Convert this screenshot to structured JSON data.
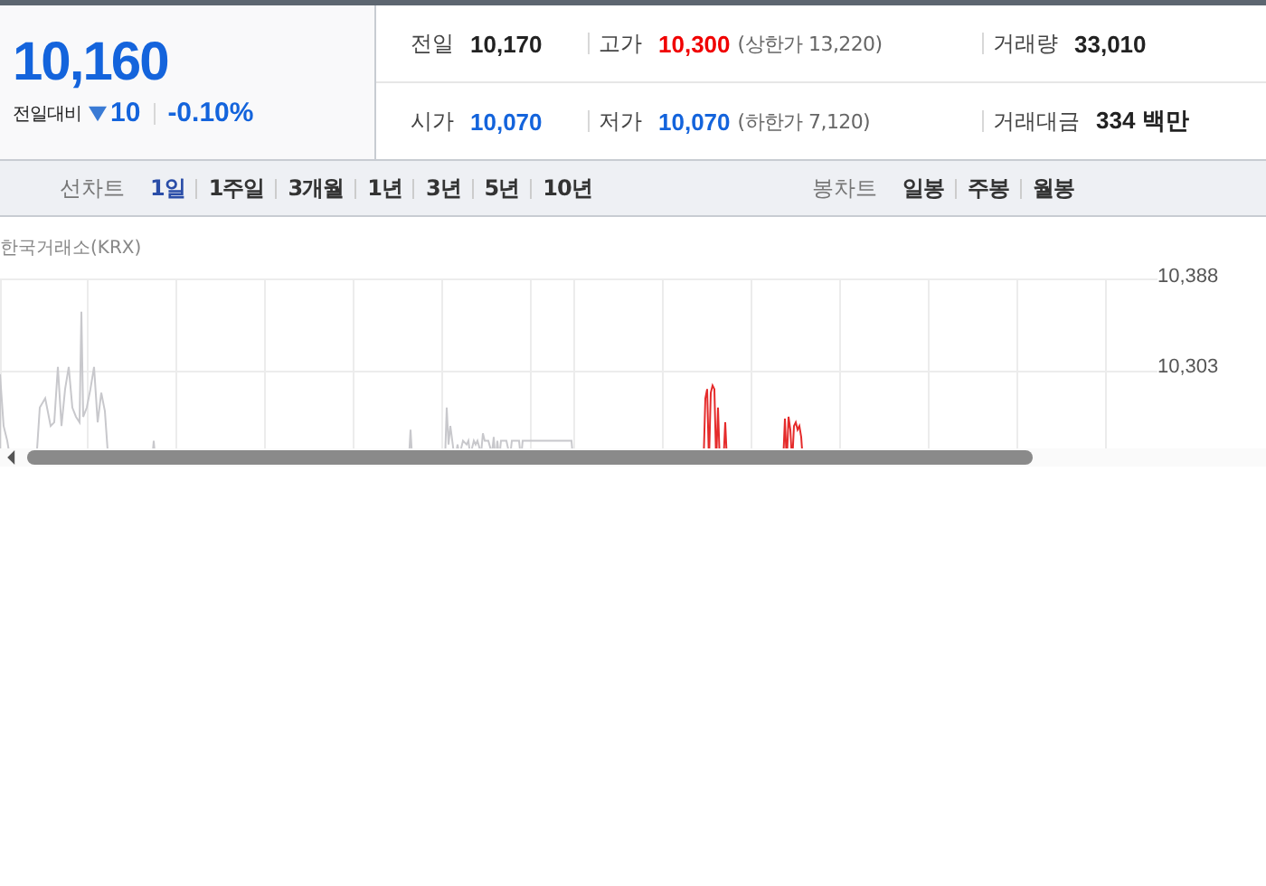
{
  "quote": {
    "price": "10,160",
    "change_label": "전일대비",
    "falling": true,
    "change": "10",
    "rate": "-0.10%"
  },
  "stats": [
    [
      {
        "label": "전일",
        "value": "10,170",
        "kind": "plain"
      },
      {
        "label": "고가",
        "value": "10,300",
        "kind": "up",
        "note": "(상한가 13,220)"
      },
      {
        "label": "거래량",
        "value": "33,010",
        "kind": "plain"
      }
    ],
    [
      {
        "label": "시가",
        "value": "10,070",
        "kind": "down"
      },
      {
        "label": "저가",
        "value": "10,070",
        "kind": "down",
        "note": "(하한가 7,120)"
      },
      {
        "label": "거래대금",
        "value": "334 백만",
        "kind": "plain"
      }
    ]
  ],
  "line_chart": {
    "label": "선차트",
    "periods": [
      {
        "label": "1일",
        "selected": true
      },
      {
        "label": "1주일",
        "selected": false
      },
      {
        "label": "3개월",
        "selected": false
      },
      {
        "label": "1년",
        "selected": false
      },
      {
        "label": "3년",
        "selected": false
      },
      {
        "label": "5년",
        "selected": false
      },
      {
        "label": "10년",
        "selected": false
      }
    ]
  },
  "candle_chart": {
    "label": "봉차트",
    "periods": [
      {
        "label": "일봉",
        "selected": false
      },
      {
        "label": "주봉",
        "selected": false
      },
      {
        "label": "월봉",
        "selected": false
      }
    ]
  },
  "chart": {
    "source": "한국거래소(KRX)",
    "y_labels": [
      "10,388",
      "10,303"
    ]
  }
}
